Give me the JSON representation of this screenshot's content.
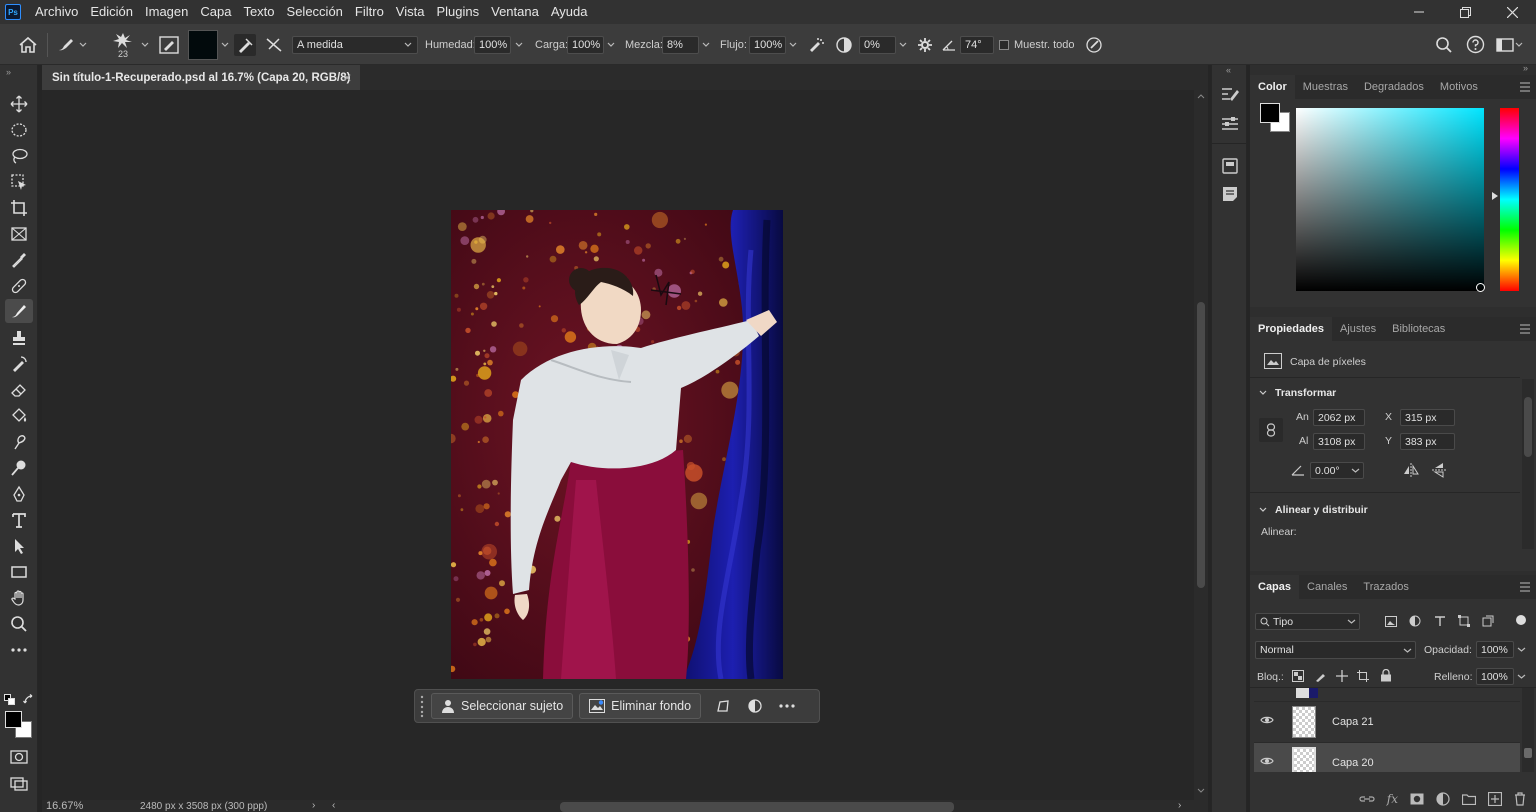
{
  "menubar": {
    "logo": "Ps",
    "items": [
      "Archivo",
      "Edición",
      "Imagen",
      "Capa",
      "Texto",
      "Selección",
      "Filtro",
      "Vista",
      "Plugins",
      "Ventana",
      "Ayuda"
    ]
  },
  "options": {
    "brush_size": "23",
    "preset": "A medida",
    "humedad_label": "Humedad:",
    "humedad_value": "100%",
    "carga_label": "Carga:",
    "carga_value": "100%",
    "mezcla_label": "Mezcla:",
    "mezcla_value": "8%",
    "flujo_label": "Flujo:",
    "flujo_value": "100%",
    "smoothing_value": "0%",
    "angle_value": "74°",
    "sample_all_label": "Muestr. todo",
    "foreground_color": "#000000"
  },
  "document": {
    "tab_title": "Sin título-1-Recuperado.psd al 16.7% (Capa 20, RGB/8)",
    "zoom": "16.67%",
    "doc_info": "2480 px x 3508 px (300 ppp)"
  },
  "context_bar": {
    "select_subject": "Seleccionar sujeto",
    "remove_background": "Eliminar fondo"
  },
  "color_panel": {
    "tabs": [
      "Color",
      "Muestras",
      "Degradados",
      "Motivos"
    ],
    "hue_color": "#00e5ff"
  },
  "properties_panel": {
    "tabs": [
      "Propiedades",
      "Ajustes",
      "Bibliotecas"
    ],
    "layer_type": "Capa de píxeles",
    "transform_title": "Transformar",
    "w_label": "An",
    "w_value": "2062 px",
    "h_label": "Al",
    "h_value": "3108 px",
    "x_label": "X",
    "x_value": "315 px",
    "y_label": "Y",
    "y_value": "383 px",
    "angle_value": "0.00°",
    "align_title": "Alinear y distribuir",
    "align_label": "Alinear:"
  },
  "layers_panel": {
    "tabs": [
      "Capas",
      "Canales",
      "Trazados"
    ],
    "filter": "Tipo",
    "blend_mode": "Normal",
    "opacity_label": "Opacidad:",
    "opacity_value": "100%",
    "lock_label": "Bloq.:",
    "fill_label": "Relleno:",
    "fill_value": "100%",
    "layers": [
      {
        "name": "Capa 21",
        "visible": true,
        "selected": false
      },
      {
        "name": "Capa 20",
        "visible": true,
        "selected": true
      }
    ]
  }
}
